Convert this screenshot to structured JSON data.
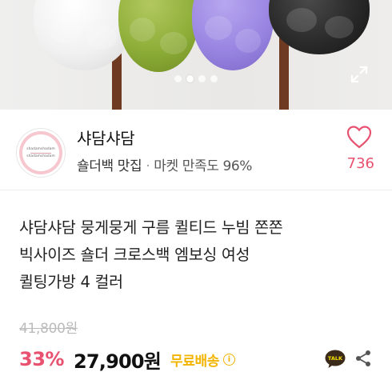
{
  "carousel": {
    "slide_count": 4,
    "active_index": 1,
    "icons": {
      "expand": "expand-icon"
    }
  },
  "seller": {
    "name": "샤담샤담",
    "tagline": "숄더백 맛집",
    "separator": "·",
    "market_text": "마켓 만족도 96%",
    "logo_text": [
      "shadamshadam",
      "shadamshadam"
    ],
    "likes": "736",
    "icons": {
      "like": "heart-icon"
    }
  },
  "product": {
    "title_lines": [
      "샤담샤담 뭉게뭉게 구름 퀼티드 누빔 쫀쫀",
      "빅사이즈 숄더 크로스백 엠보싱 여성",
      "퀼팅가방 4 컬러"
    ],
    "original_price": "41,800원",
    "discount": "33%",
    "price": "27,900원",
    "shipping": "무료배송",
    "shipping_info_glyph": "i",
    "talk_label": "TALK",
    "icons": {
      "talk": "kakao-talk-icon",
      "share": "share-icon",
      "info": "info-icon"
    }
  },
  "colors": {
    "accent_pink": "#e8516f",
    "shipping_yellow": "#f3b400",
    "kakao_yellow": "#f9e000"
  }
}
